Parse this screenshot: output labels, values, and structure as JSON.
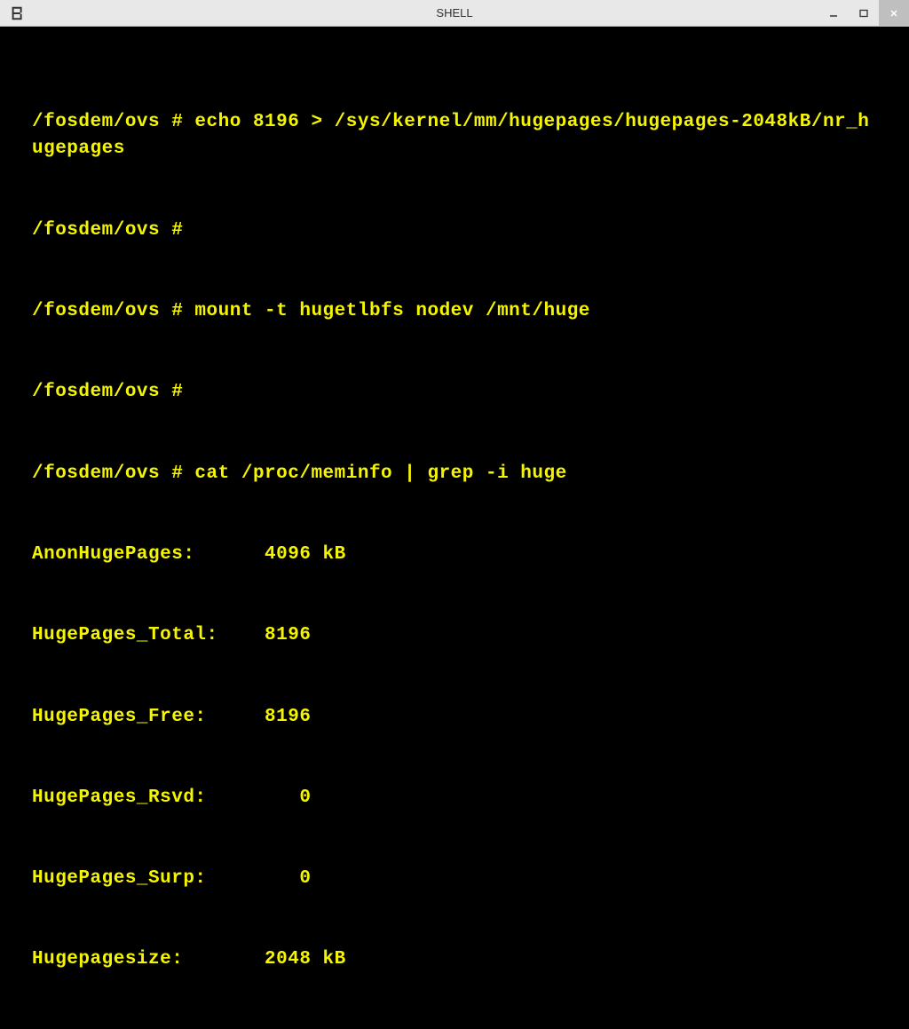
{
  "window": {
    "title": "SHELL"
  },
  "terminal": {
    "lines": [
      "/fosdem/ovs # echo 8196 > /sys/kernel/mm/hugepages/hugepages-2048kB/nr_hugepages",
      "/fosdem/ovs #",
      "/fosdem/ovs # mount -t hugetlbfs nodev /mnt/huge",
      "/fosdem/ovs #",
      "/fosdem/ovs # cat /proc/meminfo | grep -i huge",
      "AnonHugePages:      4096 kB",
      "HugePages_Total:    8196",
      "HugePages_Free:     8196",
      "HugePages_Rsvd:        0",
      "HugePages_Surp:        0",
      "Hugepagesize:       2048 kB"
    ]
  }
}
